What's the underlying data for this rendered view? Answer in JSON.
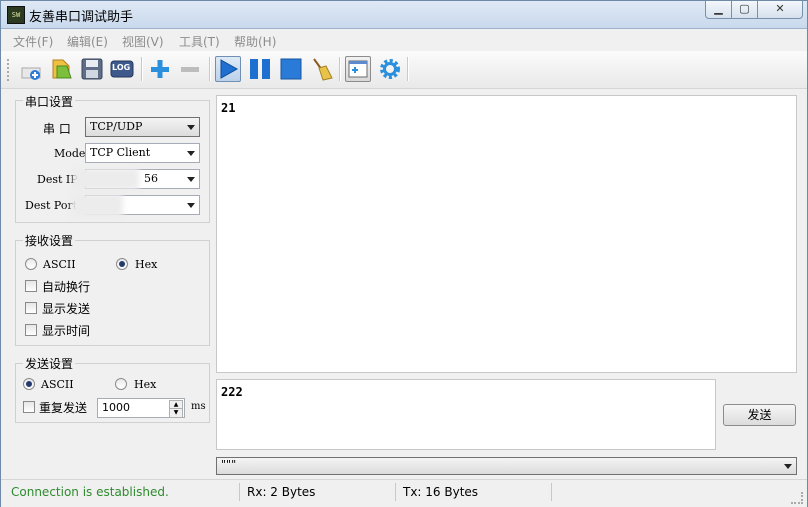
{
  "window": {
    "title": "友善串口调试助手",
    "icon_text": "SW"
  },
  "menu": [
    "文件(F)",
    "编辑(E)",
    "视图(V)",
    "工具(T)",
    "帮助(H)"
  ],
  "toolbar": {
    "log_label": "LOG",
    "icons": [
      "new-icon",
      "open-icon",
      "save-icon",
      "log-icon",
      "add-icon",
      "remove-icon",
      "play-icon",
      "pause-icon",
      "stop-icon",
      "broom-icon",
      "window-icon",
      "gear-icon"
    ]
  },
  "serial_settings": {
    "title": "串口设置",
    "port_label": "串  口",
    "port_value": "TCP/UDP",
    "mode_label": "Mode",
    "mode_value": "TCP Client",
    "dest_ip_label": "Dest IP",
    "dest_ip_value": "56",
    "dest_port_label": "Dest Port",
    "dest_port_value": ""
  },
  "receive_settings": {
    "title": "接收设置",
    "ascii_label": "ASCII",
    "hex_label": "Hex",
    "auto_wrap": "自动换行",
    "show_send": "显示发送",
    "show_time": "显示时间"
  },
  "send_settings": {
    "title": "发送设置",
    "ascii_label": "ASCII",
    "hex_label": "Hex",
    "repeat_label": "重复发送",
    "interval_value": "1000",
    "interval_unit": "ms"
  },
  "receive_area": {
    "text": "21"
  },
  "send_area": {
    "text": "222"
  },
  "send_button": "发送",
  "history_combo": {
    "value": "\"\"\""
  },
  "status": {
    "connection": "Connection is established.",
    "connection_color": "#2e8b2e",
    "rx": "Rx: 2 Bytes",
    "tx": "Tx: 16 Bytes"
  }
}
